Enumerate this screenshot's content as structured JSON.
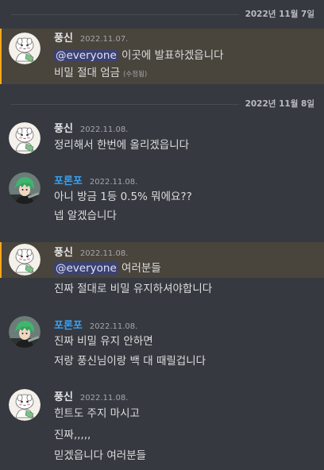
{
  "dividers": [
    {
      "date": "2022년 11월 7일"
    },
    {
      "date": "2022년 11월 8일"
    }
  ],
  "users": {
    "pungsin": {
      "name": "풍신",
      "color": "#e3e5e8",
      "avatar_icon": "white-creature-avatar-icon"
    },
    "poronpo": {
      "name": "포론포",
      "color": "#3aa0f2",
      "avatar_icon": "green-hair-character-avatar-icon"
    }
  },
  "groups": [
    {
      "user": "pungsin",
      "timestamp": "2022.11.07.",
      "highlighted": true,
      "lines": [
        {
          "mention": "@everyone",
          "text": " 이곳에 발표하겠읍니다"
        },
        {
          "text": "비밀 절대 엄금",
          "edited": "(수정됨)"
        }
      ]
    },
    {
      "user": "pungsin",
      "timestamp": "2022.11.08.",
      "highlighted": false,
      "lines": [
        {
          "text": "정리해서 한번에 올리겠읍니다"
        }
      ]
    },
    {
      "user": "poronpo",
      "timestamp": "2022.11.08.",
      "highlighted": false,
      "lines": [
        {
          "text": "아니 방금 1등 0.5% 뭐에요??"
        },
        {
          "text": "넵 알겠습니다"
        }
      ]
    },
    {
      "user": "pungsin",
      "timestamp": "2022.11.08.",
      "highlighted": true,
      "lines": [
        {
          "mention": "@everyone",
          "text": " 여러분들"
        },
        {
          "text": "진짜 절대로 비밀 유지하셔야합니다"
        }
      ]
    },
    {
      "user": "poronpo",
      "timestamp": "2022.11.08.",
      "highlighted": false,
      "lines": [
        {
          "text": "진짜 비밀 유지 안하면"
        },
        {
          "text": "저랑 풍신님이랑 백 대 때릴겁니다"
        }
      ]
    },
    {
      "user": "pungsin",
      "timestamp": "2022.11.08.",
      "highlighted": false,
      "lines": [
        {
          "text": "힌트도 주지 마시고"
        },
        {
          "text": "진짜,,,,,"
        },
        {
          "text": "믿겠읍니다 여러분들"
        }
      ]
    }
  ]
}
